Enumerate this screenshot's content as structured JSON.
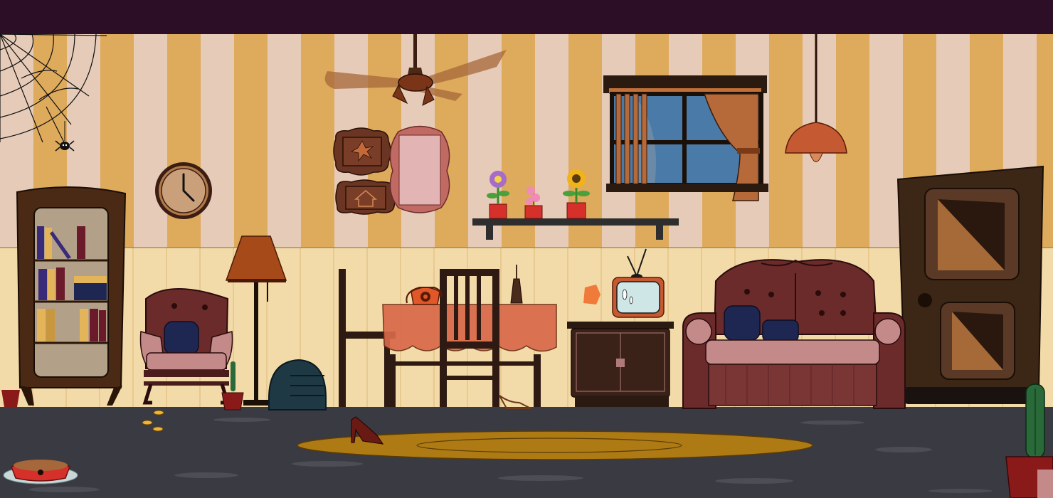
{
  "scene": {
    "name": "abandoned-living-room",
    "colors": {
      "top_bar": "#2c0f26",
      "wall_stripe_light": "#e6cbb8",
      "wall_stripe_dark": "#deaa5c",
      "wainscot": "#f2d9a6",
      "floor": "#3a3a42",
      "rug": "#ad7a14",
      "wood_dark": "#2e1a12",
      "upholstery": "#6b2b2b",
      "cushion_blue": "#1e2752"
    },
    "items": [
      {
        "id": "spider-web",
        "icon": "cobweb-icon",
        "interactable": false
      },
      {
        "id": "spider",
        "icon": "spider-icon",
        "interactable": true
      },
      {
        "id": "wall-clock",
        "icon": "clock-icon",
        "interactable": true
      },
      {
        "id": "bookshelf",
        "icon": "bookshelf-icon",
        "interactable": true
      },
      {
        "id": "ceiling-fan",
        "icon": "fan-icon",
        "interactable": true
      },
      {
        "id": "leaf-frame",
        "icon": "leaf-frame-icon",
        "interactable": true
      },
      {
        "id": "house-frame",
        "icon": "house-frame-icon",
        "interactable": true
      },
      {
        "id": "mirror",
        "icon": "mirror-icon",
        "interactable": true
      },
      {
        "id": "potted-flowers",
        "icon": "flower-pot-icon",
        "interactable": true
      },
      {
        "id": "window",
        "icon": "window-icon",
        "interactable": true
      },
      {
        "id": "pendant-lamp",
        "icon": "lamp-icon",
        "interactable": true
      },
      {
        "id": "wooden-door",
        "icon": "door-icon",
        "interactable": true
      },
      {
        "id": "armchair",
        "icon": "armchair-icon",
        "interactable": true
      },
      {
        "id": "floor-lamp",
        "icon": "floor-lamp-icon",
        "interactable": true
      },
      {
        "id": "dining-table",
        "icon": "table-icon",
        "interactable": true
      },
      {
        "id": "rotary-phone",
        "icon": "phone-icon",
        "interactable": true
      },
      {
        "id": "tv-set",
        "icon": "tv-icon",
        "interactable": true
      },
      {
        "id": "sofa",
        "icon": "sofa-icon",
        "interactable": true
      },
      {
        "id": "blue-backpack",
        "icon": "backpack-icon",
        "interactable": true
      },
      {
        "id": "cactus",
        "icon": "cactus-icon",
        "interactable": true
      },
      {
        "id": "pet-bowl",
        "icon": "pet-bowl-icon",
        "interactable": true
      },
      {
        "id": "high-heel",
        "icon": "shoe-icon",
        "interactable": true
      },
      {
        "id": "coins",
        "icon": "coin-icon",
        "interactable": true
      },
      {
        "id": "rug",
        "icon": "rug-icon",
        "interactable": false
      }
    ]
  }
}
